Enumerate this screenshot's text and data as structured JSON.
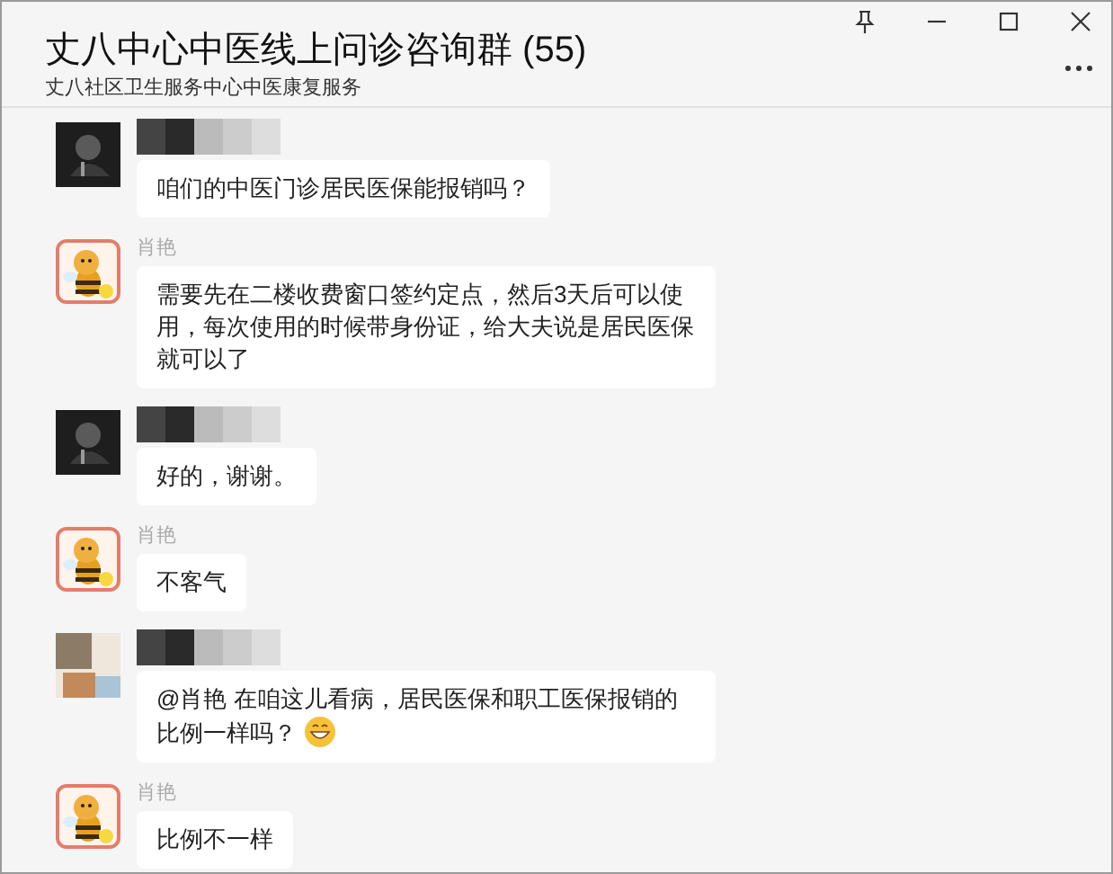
{
  "window": {
    "title": "丈八中心中医线上问诊咨询群 (55)",
    "subtitle": "丈八社区卫生服务中心中医康复服务"
  },
  "messages": [
    {
      "avatar": {
        "kind": "dark"
      },
      "sender_redacted": true,
      "text": "咱们的中医门诊居民医保能报销吗？"
    },
    {
      "avatar": {
        "kind": "bee"
      },
      "sender": "肖艳",
      "text": "需要先在二楼收费窗口签约定点，然后3天后可以使用，每次使用的时候带身份证，给大夫说是居民医保就可以了"
    },
    {
      "avatar": {
        "kind": "dark"
      },
      "sender_redacted": true,
      "text": "好的，谢谢。"
    },
    {
      "avatar": {
        "kind": "bee"
      },
      "sender": "肖艳",
      "text": "不客气"
    },
    {
      "sender_redacted": true,
      "text": "@肖艳 在咱这儿看病，居民医保和职工医保报销的比例一样吗？",
      "emoji": {
        "kind": "grin"
      }
    },
    {
      "avatar": {
        "kind": "bee"
      },
      "sender": "肖艳",
      "text": "比例不一样"
    }
  ]
}
